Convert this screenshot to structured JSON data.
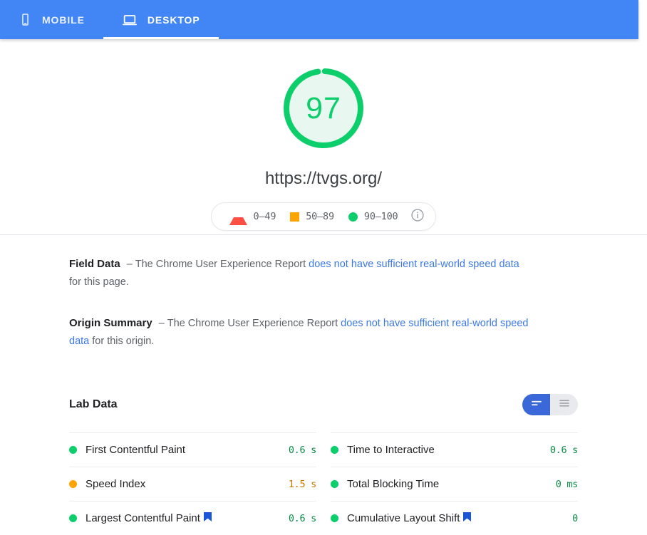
{
  "header": {
    "tabs": [
      {
        "label": "MOBILE",
        "icon": "mobile-phone-icon",
        "active": false
      },
      {
        "label": "DESKTOP",
        "icon": "laptop-icon",
        "active": true
      }
    ],
    "background_color": "#4285f4"
  },
  "score": {
    "value": "97",
    "value_number": 97,
    "max": 100,
    "color": "#0cce6b",
    "url": "https://tvgs.org/"
  },
  "legend": {
    "items": [
      {
        "glyph": "triangle",
        "range": "0–49",
        "color": "#ff4e42"
      },
      {
        "glyph": "square",
        "range": "50–89",
        "color": "#ffa400"
      },
      {
        "glyph": "circle",
        "range": "90–100",
        "color": "#0cce6b"
      }
    ],
    "info_icon": "info-icon"
  },
  "field_data": {
    "title": "Field Data",
    "dash": "–",
    "text_before": "The Chrome User Experience Report",
    "link_text": "does not have sufficient real-world speed data",
    "text_after": " for this page."
  },
  "origin_summary": {
    "title": "Origin Summary",
    "dash": "–",
    "text_before": "The Chrome User Experience Report",
    "link_text": "does not have sufficient real-world speed data",
    "text_after": " for this origin."
  },
  "lab_data": {
    "title": "Lab Data",
    "view_toggle": {
      "active_label": "compact-view",
      "inactive_label": "expanded-view",
      "active_color": "#3b68d8",
      "inactive_color": "#e8eaed"
    },
    "columns": [
      {
        "rows": [
          {
            "status": "green",
            "name": "First Contentful Paint",
            "flag": false,
            "value": "0.6 s"
          },
          {
            "status": "orange",
            "name": "Speed Index",
            "flag": false,
            "value": "1.5 s"
          },
          {
            "status": "green",
            "name": "Largest Contentful Paint",
            "flag": true,
            "value": "0.6 s"
          }
        ]
      },
      {
        "rows": [
          {
            "status": "green",
            "name": "Time to Interactive",
            "flag": false,
            "value": "0.6 s"
          },
          {
            "status": "green",
            "name": "Total Blocking Time",
            "flag": false,
            "value": "0 ms"
          },
          {
            "status": "green",
            "name": "Cumulative Layout Shift",
            "flag": true,
            "value": "0"
          }
        ]
      }
    ]
  }
}
